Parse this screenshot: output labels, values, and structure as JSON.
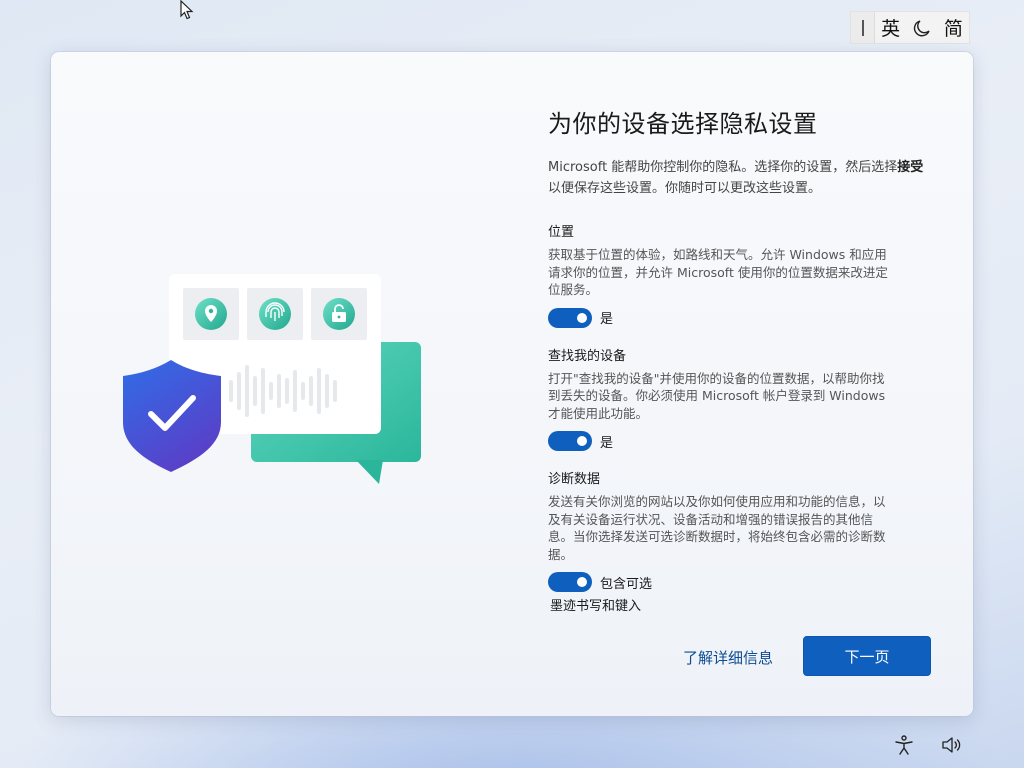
{
  "ime": {
    "mode_label": "英",
    "charset_label": "简",
    "icons": [
      "grip-icon",
      "moon-icon"
    ]
  },
  "page": {
    "title": "为你的设备选择隐私设置",
    "intro_part1": "Microsoft 能帮助你控制你的隐私。选择你的设置，然后选择",
    "intro_bold": "接受",
    "intro_part2": "以便保存这些设置。你随时可以更改这些设置。"
  },
  "settings": [
    {
      "heading": "位置",
      "description": "获取基于位置的体验，如路线和天气。允许 Windows 和应用请求你的位置，并允许 Microsoft 使用你的位置数据来改进定位服务。",
      "toggle_on": true,
      "toggle_label": "是"
    },
    {
      "heading": "查找我的设备",
      "description": "打开\"查找我的设备\"并使用你的设备的位置数据，以帮助你找到丢失的设备。你必须使用 Microsoft 帐户登录到 Windows 才能使用此功能。",
      "toggle_on": true,
      "toggle_label": "是"
    },
    {
      "heading": "诊断数据",
      "description": "发送有关你浏览的网站以及你如何使用应用和功能的信息，以及有关设备运行状况、设备活动和增强的错误报告的其他信息。当你选择发送可选诊断数据时，将始终包含必需的诊断数据。",
      "toggle_on": true,
      "toggle_label": "包含可选"
    }
  ],
  "next_setting_heading": "墨迹书写和键入",
  "actions": {
    "learn_more": "了解详细信息",
    "next": "下一页"
  },
  "colors": {
    "accent": "#0f5fbe",
    "teal": "#3cc4a8",
    "shield": "#3a55d6"
  },
  "tray_icons": [
    "accessibility-icon",
    "volume-icon"
  ]
}
